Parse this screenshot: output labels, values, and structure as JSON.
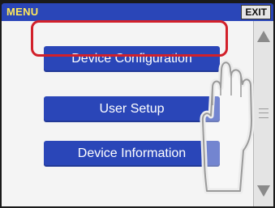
{
  "titlebar": {
    "title": "MENU",
    "exit_label": "EXIT"
  },
  "menu": {
    "items": [
      {
        "label": "Device Configuration",
        "selected": true
      },
      {
        "label": "User Setup"
      },
      {
        "label": "Device Information"
      }
    ]
  },
  "colors": {
    "titlebar": "#2a46b8",
    "title_text": "#ffe85a",
    "button": "#2a46b8",
    "highlight": "#d2202a"
  },
  "icons": {
    "scroll_up": "triangle-up",
    "scroll_down": "triangle-down",
    "scroll_thumb": "grip-lines",
    "pointer": "hand-pointer"
  }
}
